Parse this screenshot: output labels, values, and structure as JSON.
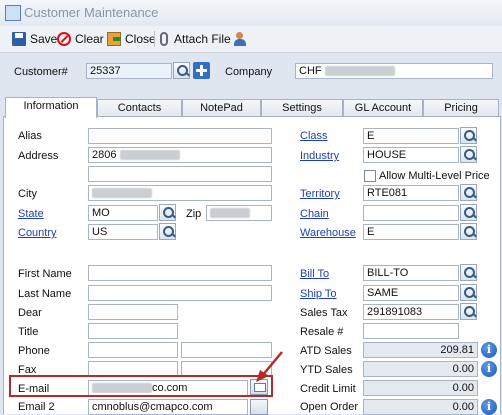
{
  "window": {
    "title": "Customer Maintenance"
  },
  "toolbar": {
    "save": "Save",
    "clear": "Clear",
    "close": "Close",
    "attach": "Attach File"
  },
  "header": {
    "customer_label": "Customer#",
    "customer_value": "25337",
    "company_label": "Company",
    "company_value": "CHF"
  },
  "tabs": [
    "Information",
    "Contacts",
    "NotePad",
    "Settings",
    "GL Account",
    "Pricing"
  ],
  "left": {
    "alias_label": "Alias",
    "alias_value": "",
    "address_label": "Address",
    "address_value": "2806",
    "city_label": "City",
    "city_value": "",
    "state_label": "State",
    "state_value": "MO",
    "zip_label": "Zip",
    "country_label": "Country",
    "country_value": "US",
    "first_name_label": "First Name",
    "last_name_label": "Last Name",
    "dear_label": "Dear",
    "title_label": "Title",
    "phone_label": "Phone",
    "fax_label": "Fax",
    "email_label": "E-mail",
    "email_value": "co.com",
    "email2_label": "Email 2",
    "email2_value": "cmnoblus@cmapco.com"
  },
  "right": {
    "class_label": "Class",
    "class_value": "E",
    "industry_label": "Industry",
    "industry_value": "HOUSE",
    "multi_level_label": "Allow Multi-Level Price",
    "territory_label": "Territory",
    "territory_value": "RTE081",
    "chain_label": "Chain",
    "chain_value": "",
    "warehouse_label": "Warehouse",
    "warehouse_value": "E",
    "bill_to_label": "Bill To",
    "bill_to_value": "BILL-TO",
    "ship_to_label": "Ship To",
    "ship_to_value": "SAME",
    "sales_tax_label": "Sales Tax",
    "sales_tax_value": "291891083",
    "resale_label": "Resale #",
    "resale_value": "",
    "atd_label": "ATD Sales",
    "atd_value": "209.81",
    "ytd_label": "YTD Sales",
    "ytd_value": "0.00",
    "credit_label": "Credit Limit",
    "credit_value": "0.00",
    "open_order_label": "Open Order",
    "open_order_value": "0.00"
  },
  "colors": {
    "highlight": "#b52a2a",
    "link": "#1f3fb5",
    "info": "#1c56b8"
  }
}
